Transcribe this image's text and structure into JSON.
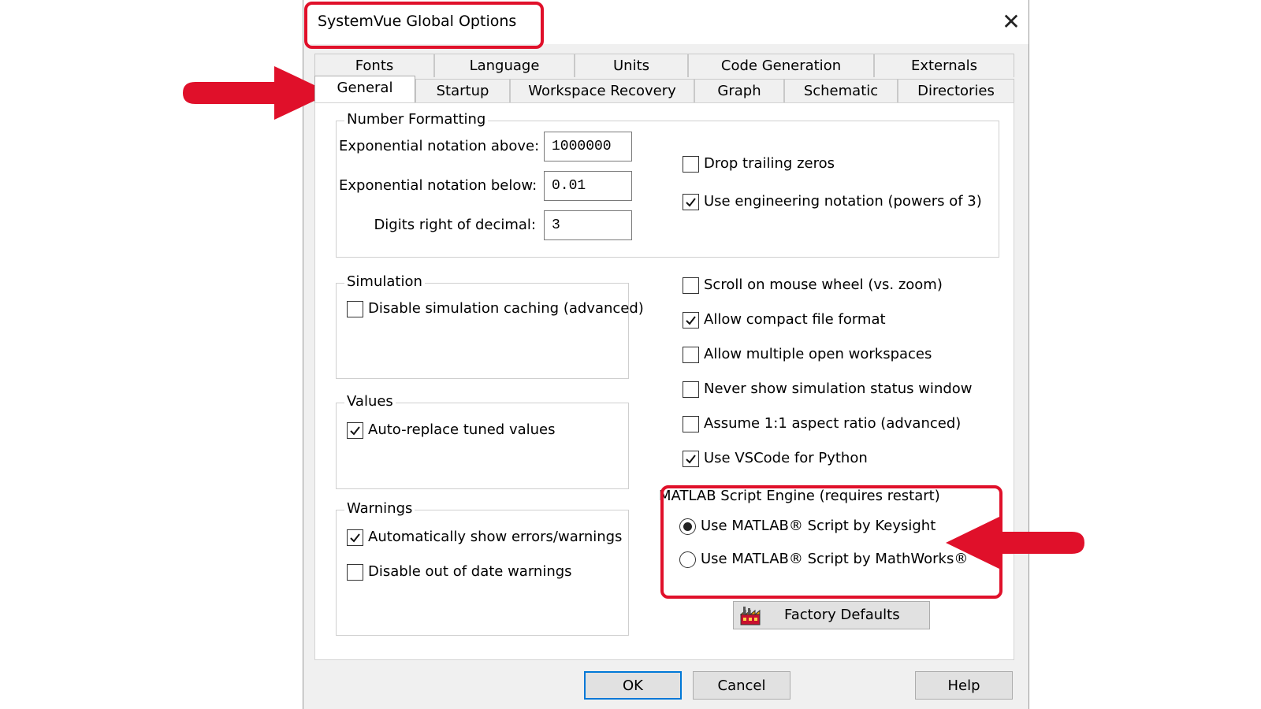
{
  "dialog": {
    "title": "SystemVue Global Options",
    "close_label": "✕"
  },
  "tabs": {
    "row1": [
      "Fonts",
      "Language",
      "Units",
      "Code Generation",
      "Externals"
    ],
    "row2": [
      "General",
      "Startup",
      "Workspace Recovery",
      "Graph",
      "Schematic",
      "Directories"
    ],
    "active": "General"
  },
  "number_formatting": {
    "legend": "Number Formatting",
    "exp_above_label": "Exponential notation above:",
    "exp_above_value": "1000000",
    "exp_below_label": "Exponential notation below:",
    "exp_below_value": "0.01",
    "digits_label": "Digits right of decimal:",
    "digits_value": "3",
    "drop_trailing_zeros": {
      "label": "Drop trailing zeros",
      "checked": false
    },
    "engineering_notation": {
      "label": "Use engineering notation (powers of 3)",
      "checked": true
    }
  },
  "simulation": {
    "legend": "Simulation",
    "disable_caching": {
      "label": "Disable simulation caching (advanced)",
      "checked": false
    }
  },
  "values": {
    "legend": "Values",
    "auto_replace": {
      "label": "Auto-replace tuned values",
      "checked": true
    }
  },
  "warnings": {
    "legend": "Warnings",
    "auto_show": {
      "label": "Automatically show errors/warnings",
      "checked": true
    },
    "disable_out_of_date": {
      "label": "Disable out of date warnings",
      "checked": false
    }
  },
  "general_options": {
    "scroll_mouse_wheel": {
      "label": "Scroll on mouse wheel (vs. zoom)",
      "checked": false
    },
    "compact_file_format": {
      "label": "Allow compact file format",
      "checked": true
    },
    "multiple_workspaces": {
      "label": "Allow multiple open workspaces",
      "checked": false
    },
    "never_show_status": {
      "label": "Never show simulation status window",
      "checked": false
    },
    "aspect_ratio": {
      "label": "Assume 1:1 aspect ratio (advanced)",
      "checked": false
    },
    "vscode_python": {
      "label": "Use VSCode for Python",
      "checked": true
    }
  },
  "matlab_engine": {
    "legend": "MATLAB Script Engine (requires restart)",
    "keysight": {
      "label": "Use MATLAB® Script by Keysight",
      "selected": true
    },
    "mathworks": {
      "label": "Use MATLAB® Script by MathWorks®",
      "selected": false
    }
  },
  "buttons": {
    "factory_defaults": "Factory Defaults",
    "ok": "OK",
    "cancel": "Cancel",
    "help": "Help"
  },
  "colors": {
    "highlight": "#e0102a",
    "default_button_border": "#0078d7"
  },
  "icons": {
    "factory_defaults": "factory-icon",
    "check": "checkmark-icon",
    "close": "close-icon",
    "annotation": "red-arrow-icon"
  }
}
